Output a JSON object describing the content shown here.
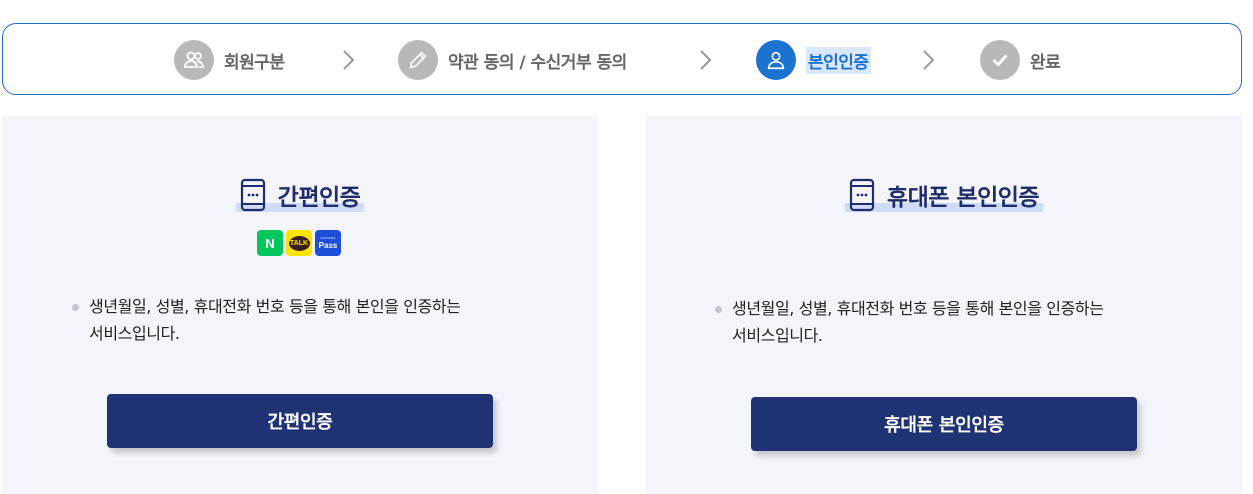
{
  "stepper": {
    "steps": [
      {
        "label": "회원구분",
        "icon": "users-icon",
        "state": "inactive"
      },
      {
        "label": "약관 동의 / 수신거부 동의",
        "icon": "pencil-icon",
        "state": "inactive"
      },
      {
        "label": "본인인증",
        "icon": "user-icon",
        "state": "active"
      },
      {
        "label": "완료",
        "icon": "check-icon",
        "state": "inactive"
      }
    ]
  },
  "simple_auth": {
    "title": "간편인증",
    "icon": "mobile-phone-icon",
    "providers": [
      {
        "name": "naver",
        "text": "N",
        "color": "#03c75a"
      },
      {
        "name": "kakao",
        "text": "TALK",
        "color": "#fee500"
      },
      {
        "name": "pass",
        "text_small": "SAMSUNG",
        "text": "Pass",
        "color": "#1d4ed8"
      }
    ],
    "desc_line1": "생년월일, 성별, 휴대전화 번호 등을 통해 본인을 인증하는",
    "desc_line2": "서비스입니다.",
    "button": "간편인증"
  },
  "phone_auth": {
    "title": "휴대폰 본인인증",
    "icon": "mobile-phone-icon",
    "desc_line1": "생년월일, 성별, 휴대전화 번호 등을 통해 본인을 인증하는",
    "desc_line2": "서비스입니다.",
    "button": "휴대폰 본인인증"
  },
  "colors": {
    "accent": "#1a73d1",
    "button": "#1f3374",
    "title": "#1f2d6b",
    "panel_bg": "#f4f5fa",
    "inactive_step": "#b8b8b8"
  }
}
